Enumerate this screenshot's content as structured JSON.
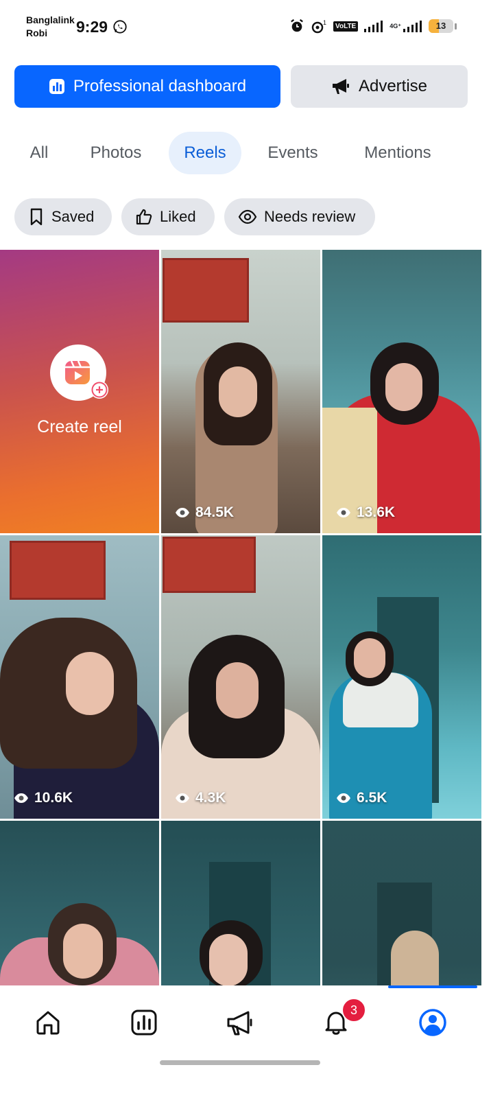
{
  "status_bar": {
    "carrier_1": "Banglalink",
    "carrier_2": "Robi",
    "time": "9:29",
    "volte": "VoLTE",
    "network": "4G⁺",
    "battery": "13"
  },
  "actions": {
    "dashboard_label": "Professional dashboard",
    "advertise_label": "Advertise"
  },
  "tabs": [
    {
      "label": "All"
    },
    {
      "label": "Photos"
    },
    {
      "label": "Reels",
      "active": true
    },
    {
      "label": "Events"
    },
    {
      "label": "Mentions"
    }
  ],
  "filters": [
    {
      "label": "Saved",
      "icon": "bookmark-icon"
    },
    {
      "label": "Liked",
      "icon": "thumbs-up-icon"
    },
    {
      "label": "Needs review",
      "icon": "eye-icon"
    }
  ],
  "grid": {
    "create_label": "Create reel",
    "reels": [
      {
        "views": "84.5K"
      },
      {
        "views": "13.6K"
      },
      {
        "views": "10.6K"
      },
      {
        "views": "4.3K"
      },
      {
        "views": "6.5K"
      },
      {
        "views": ""
      },
      {
        "views": ""
      },
      {
        "views": ""
      }
    ]
  },
  "bottom_nav": {
    "items": [
      "home-icon",
      "insights-icon",
      "megaphone-icon",
      "bell-icon",
      "profile-icon"
    ],
    "notification_count": "3",
    "active": "profile-icon"
  },
  "colors": {
    "accent": "#0866ff",
    "chip_bg": "#e4e6eb",
    "tab_active_bg": "#e7f0fc",
    "badge": "#e41e3f"
  }
}
